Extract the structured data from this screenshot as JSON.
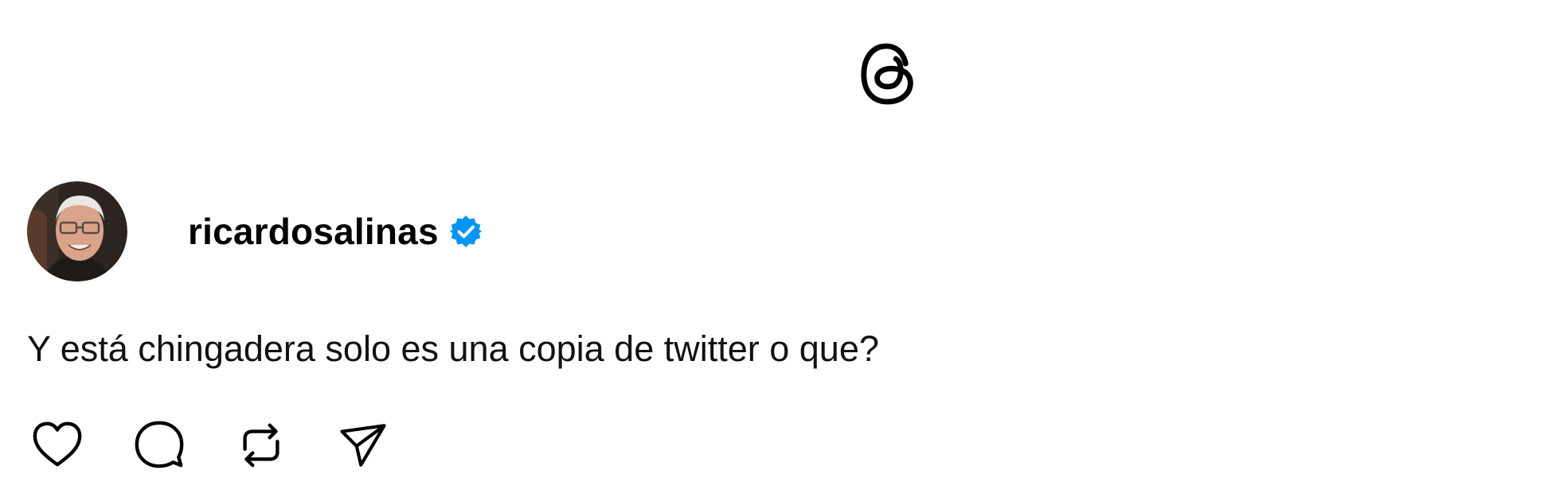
{
  "app": {
    "logo_icon": "threads-logo-icon"
  },
  "post": {
    "author": {
      "username": "ricardosalinas",
      "verified": true,
      "avatar_icon": "avatar-photo"
    },
    "text": "Y está chingadera solo es una copia de twitter o que?",
    "actions": [
      {
        "name": "like",
        "icon": "heart-icon"
      },
      {
        "name": "reply",
        "icon": "comment-icon"
      },
      {
        "name": "repost",
        "icon": "repost-icon"
      },
      {
        "name": "share",
        "icon": "send-icon"
      }
    ]
  },
  "colors": {
    "verified_blue": "#0095F6",
    "text": "#111111",
    "background": "#FFFFFF"
  }
}
